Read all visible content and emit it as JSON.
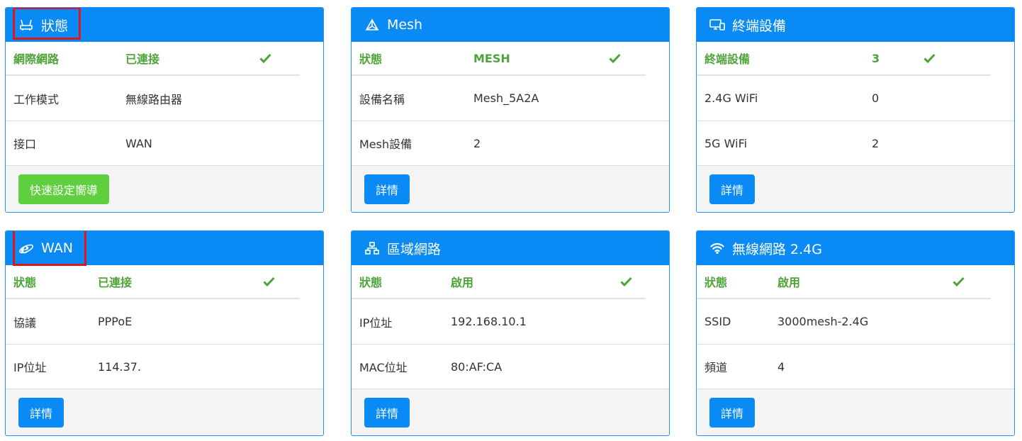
{
  "cards": [
    {
      "title": "狀態",
      "icon": "router-icon",
      "status": {
        "key": "網際網路",
        "value": "已連接"
      },
      "rows": [
        {
          "key": "工作模式",
          "value": "無線路由器"
        },
        {
          "key": "接口",
          "value": "WAN"
        }
      ],
      "button": "快速設定嚮導"
    },
    {
      "title": "Mesh",
      "icon": "mesh-icon",
      "status": {
        "key": "狀態",
        "value": "MESH"
      },
      "rows": [
        {
          "key": "設備名稱",
          "value": "Mesh_5A2A"
        },
        {
          "key": "Mesh設備",
          "value": "2"
        }
      ],
      "button": "詳情"
    },
    {
      "title": "終端設備",
      "icon": "devices-icon",
      "status": {
        "key": "終端設備",
        "value": "3"
      },
      "rows": [
        {
          "key": "2.4G WiFi",
          "value": "0"
        },
        {
          "key": "5G WiFi",
          "value": "2"
        }
      ],
      "button": "詳情"
    },
    {
      "title": "WAN",
      "icon": "internet-explorer-icon",
      "status": {
        "key": "狀態",
        "value": "已連接"
      },
      "rows": [
        {
          "key": "協議",
          "value": "PPPoE"
        },
        {
          "key": "IP位址",
          "value": "114.37."
        }
      ],
      "button": "詳情"
    },
    {
      "title": "區域網路",
      "icon": "lan-icon",
      "status": {
        "key": "狀態",
        "value": "啟用"
      },
      "rows": [
        {
          "key": "IP位址",
          "value": "192.168.10.1"
        },
        {
          "key": "MAC位址",
          "value": "80:AF:CA"
        }
      ],
      "button": "詳情"
    },
    {
      "title": "無線網路 2.4G",
      "icon": "wifi-icon",
      "status": {
        "key": "狀態",
        "value": "啟用"
      },
      "rows": [
        {
          "key": "SSID",
          "value": "3000mesh-2.4G"
        },
        {
          "key": "頻道",
          "value": "4"
        }
      ],
      "button": "詳情"
    }
  ],
  "colors": {
    "header": "#0a8af5",
    "status_green": "#4ea43a",
    "highlight_red": "#e0141b",
    "wizard_button": "#5fcf3f"
  }
}
